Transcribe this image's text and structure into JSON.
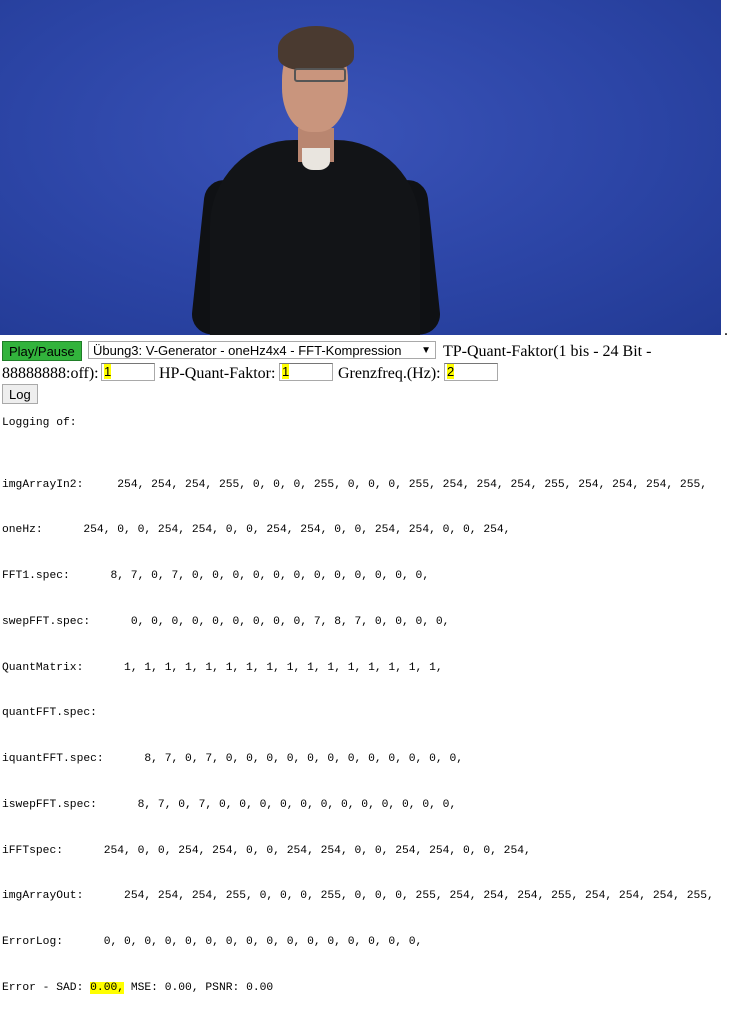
{
  "controls": {
    "play_label": "Play/Pause",
    "select_value": "Übung3: V-Generator - oneHz4x4 - FFT-Kompression",
    "tp_label_line1": "TP-Quant-Faktor(1 bis - 24 Bit -",
    "tp_label_line2": "88888888:off):",
    "tp_value": "1",
    "hp_label": "HP-Quant-Faktor:",
    "hp_value": "1",
    "grenz_label": "Grenzfreq.(Hz):",
    "grenz_value": "2",
    "log_label": "Log"
  },
  "log": {
    "heading": "Logging of:",
    "lines": [
      {
        "name": "imgArrayIn2:",
        "values": "     254, 254, 254, 255, 0, 0, 0, 255, 0, 0, 0, 255, 254, 254, 254, 255, 254, 254, 254, 255,"
      },
      {
        "name": "oneHz:",
        "values": "      254, 0, 0, 254, 254, 0, 0, 254, 254, 0, 0, 254, 254, 0, 0, 254,"
      },
      {
        "name": "FFT1.spec:",
        "values": "      8, 7, 0, 7, 0, 0, 0, 0, 0, 0, 0, 0, 0, 0, 0, 0,"
      },
      {
        "name": "swepFFT.spec:",
        "values": "      0, 0, 0, 0, 0, 0, 0, 0, 0, 7, 8, 7, 0, 0, 0, 0,"
      },
      {
        "name": "QuantMatrix:",
        "values": "      1, 1, 1, 1, 1, 1, 1, 1, 1, 1, 1, 1, 1, 1, 1, 1,"
      },
      {
        "name": "quantFFT.spec:",
        "values": ""
      },
      {
        "name": "iquantFFT.spec:",
        "values": "      8, 7, 0, 7, 0, 0, 0, 0, 0, 0, 0, 0, 0, 0, 0, 0,"
      },
      {
        "name": "iswepFFT.spec:",
        "values": "      8, 7, 0, 7, 0, 0, 0, 0, 0, 0, 0, 0, 0, 0, 0, 0,"
      },
      {
        "name": "iFFTspec:",
        "values": "      254, 0, 0, 254, 254, 0, 0, 254, 254, 0, 0, 254, 254, 0, 0, 254,"
      },
      {
        "name": "imgArrayOut:",
        "values": "      254, 254, 254, 255, 0, 0, 0, 255, 0, 0, 0, 255, 254, 254, 254, 255, 254, 254, 254, 255,"
      },
      {
        "name": "ErrorLog:",
        "values": "      0, 0, 0, 0, 0, 0, 0, 0, 0, 0, 0, 0, 0, 0, 0, 0,"
      }
    ],
    "error_prefix": "Error - SAD: ",
    "sad_value": "0.00,",
    "error_suffix": " MSE: 0.00, PSNR: 0.00"
  }
}
